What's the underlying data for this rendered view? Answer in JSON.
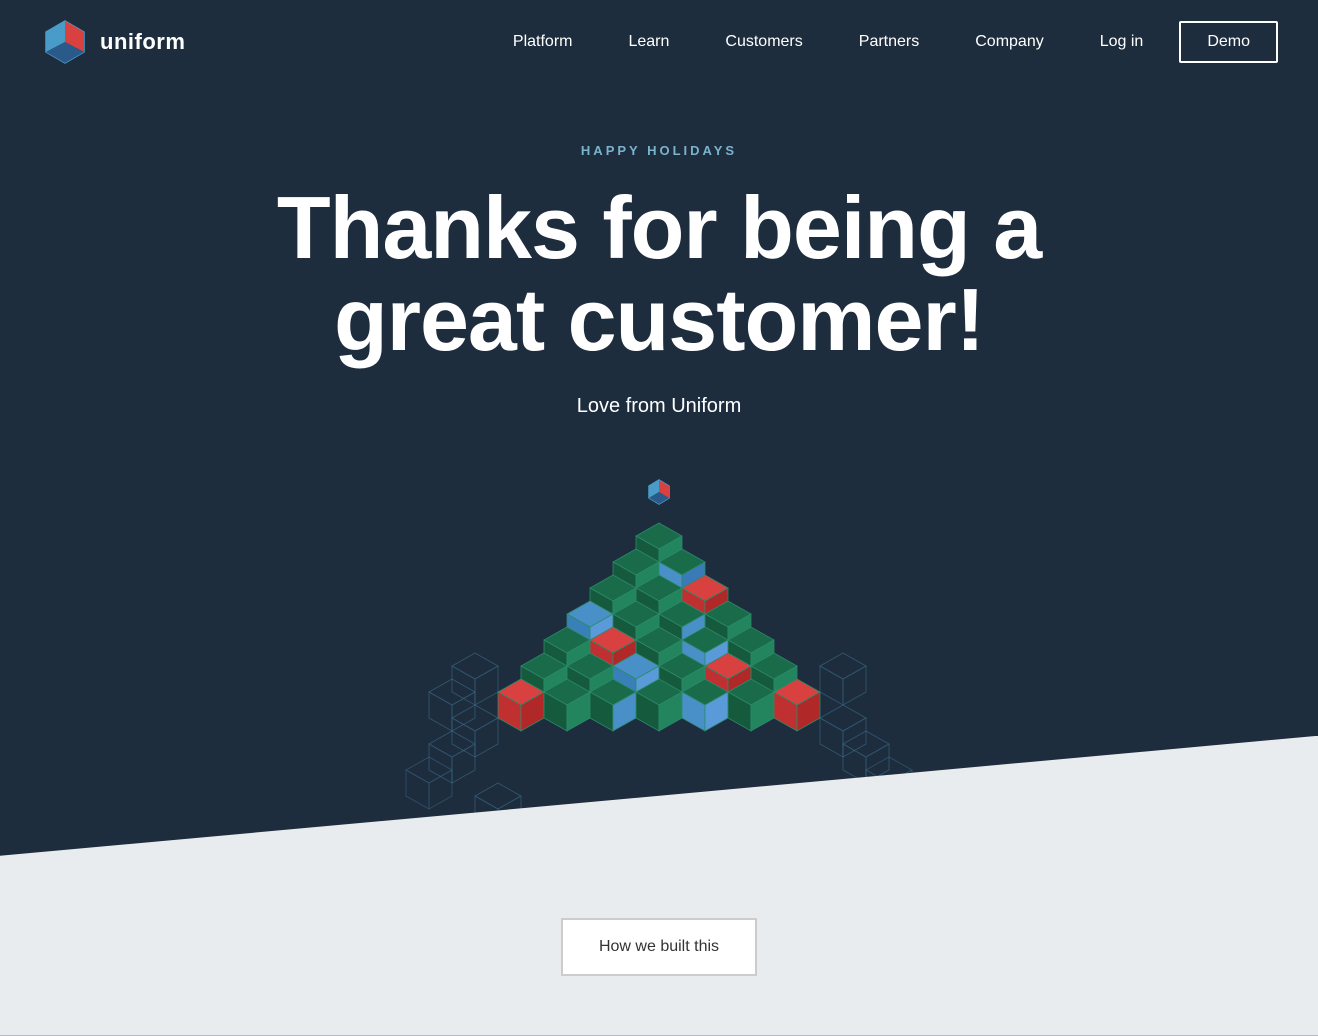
{
  "logo": {
    "text": "uniform"
  },
  "nav": {
    "items": [
      {
        "label": "Platform",
        "id": "platform"
      },
      {
        "label": "Learn",
        "id": "learn"
      },
      {
        "label": "Customers",
        "id": "customers"
      },
      {
        "label": "Partners",
        "id": "partners"
      },
      {
        "label": "Company",
        "id": "company"
      }
    ],
    "login_label": "Log in",
    "demo_label": "Demo"
  },
  "hero": {
    "subtitle": "HAPPY HOLIDAYS",
    "title": "Thanks for being a great customer!",
    "tagline": "Love from Uniform"
  },
  "cta": {
    "label": "How we built this"
  },
  "colors": {
    "bg_dark": "#1e2d3d",
    "bg_light": "#e8ecef",
    "accent_blue": "#4a9cc8",
    "accent_red": "#d94040",
    "tree_dark_green": "#1a6b4a",
    "tree_medium_green": "#22855e",
    "tree_outline": "#3a7a9c"
  }
}
